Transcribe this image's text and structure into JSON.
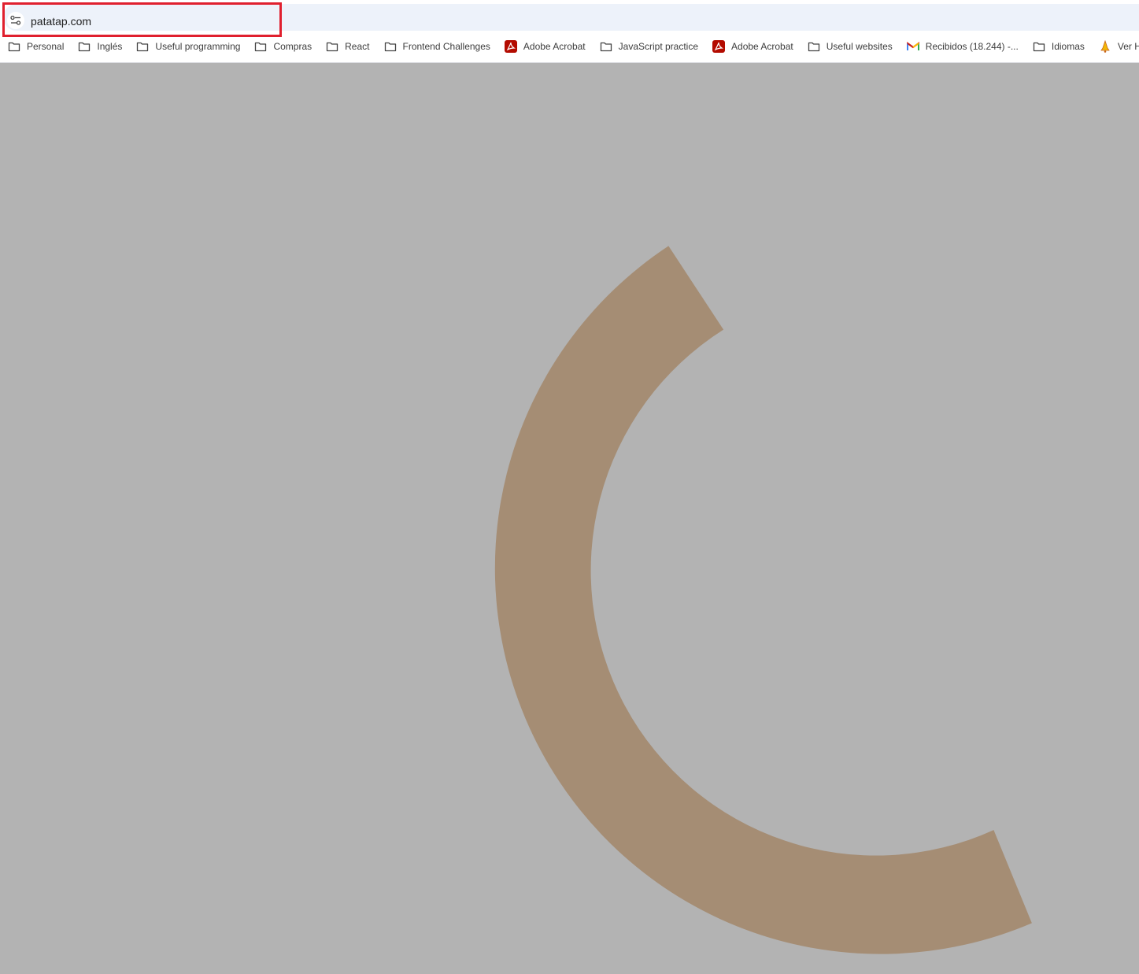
{
  "omnibox": {
    "url": "patatap.com"
  },
  "bookmarks": [
    {
      "label": "Personal",
      "icon": "folder-icon"
    },
    {
      "label": "Inglés",
      "icon": "folder-icon"
    },
    {
      "label": "Useful programming",
      "icon": "folder-icon"
    },
    {
      "label": "Compras",
      "icon": "folder-icon"
    },
    {
      "label": "React",
      "icon": "folder-icon"
    },
    {
      "label": "Frontend Challenges",
      "icon": "folder-icon"
    },
    {
      "label": "Adobe Acrobat",
      "icon": "acrobat-icon"
    },
    {
      "label": "JavaScript practice",
      "icon": "folder-icon"
    },
    {
      "label": "Adobe Acrobat",
      "icon": "acrobat-icon"
    },
    {
      "label": "Useful websites",
      "icon": "folder-icon"
    },
    {
      "label": "Recibidos (18.244) -...",
      "icon": "gmail-icon"
    },
    {
      "label": "Idiomas",
      "icon": "folder-icon"
    },
    {
      "label": "Ver Hora",
      "icon": "bell-icon"
    }
  ],
  "colors": {
    "page_background": "#b3b3b3",
    "arc": "#a58d74",
    "highlight": "#e0202e"
  },
  "canvas": {
    "shape": "arc"
  }
}
